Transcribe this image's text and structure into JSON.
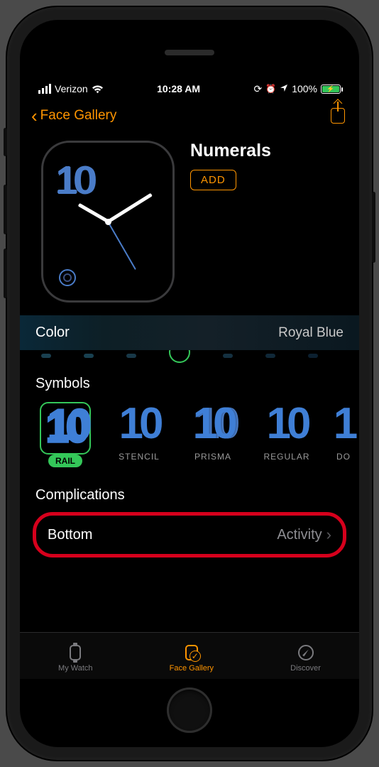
{
  "status": {
    "carrier": "Verizon",
    "time": "10:28 AM",
    "battery_pct": "100%"
  },
  "nav": {
    "back_label": "Face Gallery"
  },
  "face": {
    "title": "Numerals",
    "add_label": "ADD",
    "numeral": "10"
  },
  "color": {
    "label": "Color",
    "value": "Royal Blue"
  },
  "symbols": {
    "heading": "Symbols",
    "items": [
      {
        "glyph": "10",
        "label": "RAIL",
        "selected": true
      },
      {
        "glyph": "10",
        "label": "STENCIL",
        "selected": false
      },
      {
        "glyph": "10",
        "label": "PRISMA",
        "selected": false
      },
      {
        "glyph": "10",
        "label": "REGULAR",
        "selected": false
      },
      {
        "glyph": "1",
        "label": "DO",
        "selected": false
      }
    ]
  },
  "complications": {
    "heading": "Complications",
    "bottom_label": "Bottom",
    "bottom_value": "Activity"
  },
  "tabs": {
    "my_watch": "My Watch",
    "face_gallery": "Face Gallery",
    "discover": "Discover"
  }
}
